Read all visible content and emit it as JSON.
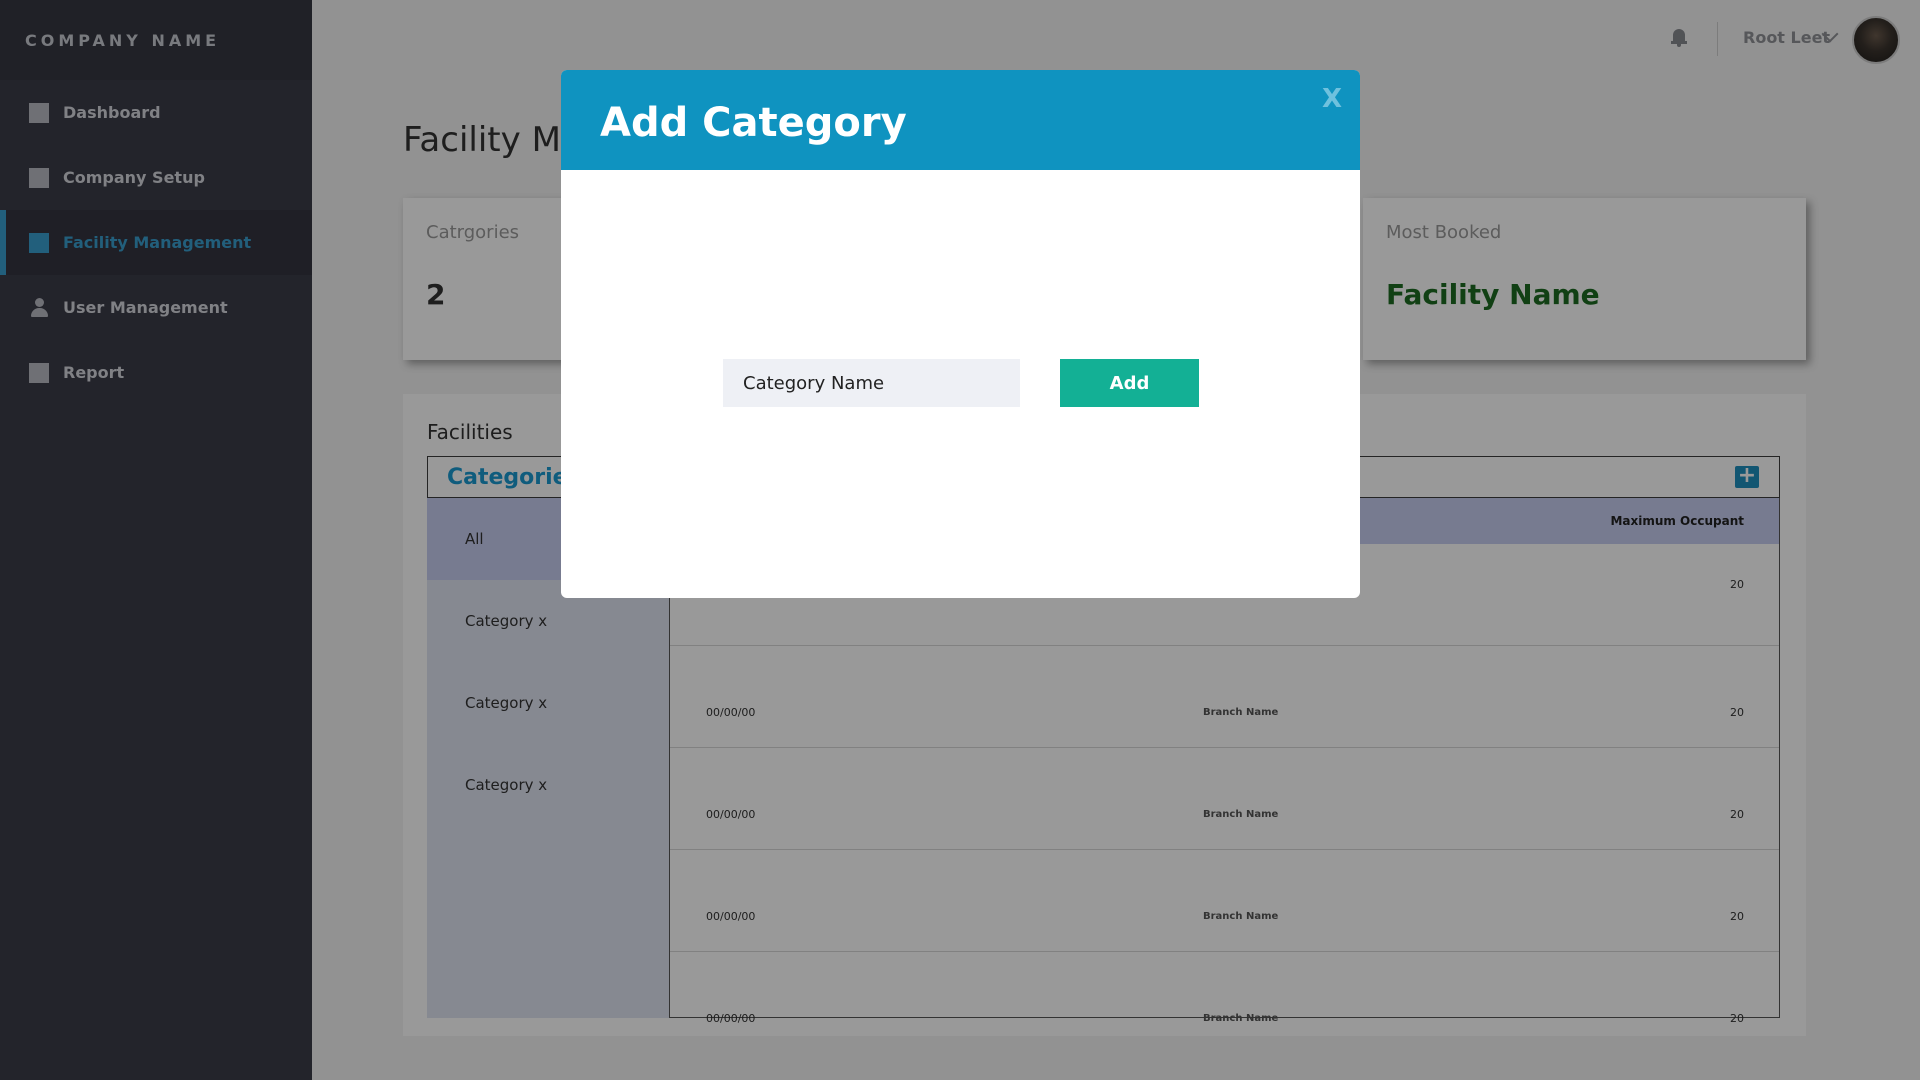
{
  "sidebar": {
    "brand": "COMPANY NAME",
    "items": [
      {
        "label": "Dashboard"
      },
      {
        "label": "Company Setup"
      },
      {
        "label": "Facility Management"
      },
      {
        "label": "User Management"
      },
      {
        "label": "Report"
      }
    ],
    "active_color": "#3a9fcf"
  },
  "topbar": {
    "user_name": "Root Leet"
  },
  "main": {
    "page_title": "Facility Management",
    "cards": [
      {
        "label": "Catrgories",
        "value": "2"
      },
      {
        "label": "Most Booked",
        "value": "Facility Name"
      }
    ],
    "facilities_title": "Facilities",
    "categories_title": "Categories",
    "category_list": [
      "All",
      "Category x",
      "Category x",
      "Category x"
    ],
    "table_header": "Maximum Occupant",
    "rows": [
      {
        "date": "",
        "branch": "",
        "max": "20"
      },
      {
        "date": "00/00/00",
        "branch": "Branch Name",
        "max": "20"
      },
      {
        "date": "00/00/00",
        "branch": "Branch Name",
        "max": "20"
      },
      {
        "date": "00/00/00",
        "branch": "Branch Name",
        "max": "20"
      },
      {
        "date": "00/00/00",
        "branch": "Branch Name",
        "max": "20"
      }
    ]
  },
  "modal": {
    "title": "Add Category",
    "close": "X",
    "input_placeholder": "Category Name",
    "add_label": "Add",
    "header_color": "#0f93c0",
    "button_color": "#13b095"
  }
}
